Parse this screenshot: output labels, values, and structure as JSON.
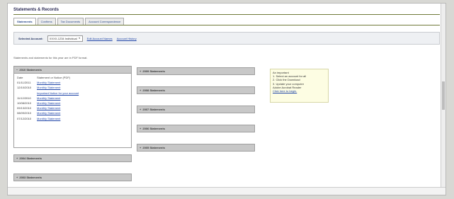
{
  "page": {
    "title": "Statements & Records",
    "intro": "Statements and statements for this year are in PDF format."
  },
  "tabs": [
    {
      "label": "Statements"
    },
    {
      "label": "Confirms"
    },
    {
      "label": "Tax Documents"
    },
    {
      "label": "Account Correspondence"
    }
  ],
  "account_bar": {
    "label": "Selected Account:",
    "selected": "XXXX-1234 Individual",
    "links": [
      "Edit Account Names",
      "Account History"
    ]
  },
  "panels": {
    "y2010": {
      "title": "2010 Statements",
      "columns": [
        "Date",
        "Statement or Notice (PDF)"
      ],
      "rows": [
        {
          "date": "01/11/2011",
          "label": "Monthly Statement"
        },
        {
          "date": "12/10/2010",
          "label": "Monthly Statement"
        },
        {
          "date": "",
          "label": "Important Notice for your account"
        },
        {
          "date": "11/12/2010",
          "label": "Monthly Statement"
        },
        {
          "date": "10/08/2010",
          "label": "Monthly Statement"
        },
        {
          "date": "09/13/2010",
          "label": "Monthly Statement"
        },
        {
          "date": "08/09/2010",
          "label": "Monthly Statement"
        },
        {
          "date": "07/12/2010",
          "label": "Monthly Statement"
        }
      ]
    },
    "y2009": {
      "title": "2009 Statements"
    },
    "y2008": {
      "title": "2008 Statements"
    },
    "y2007": {
      "title": "2007 Statements"
    },
    "y2006": {
      "title": "2006 Statements"
    },
    "y2005": {
      "title": "2005 Statements"
    },
    "y2004": {
      "title": "2004 Statements"
    },
    "y2003": {
      "title": "2003 Statements"
    }
  },
  "tip": {
    "lines": [
      "An important",
      "1. Select an account for all",
      "2. Click the Download",
      "3. Update your computer",
      "Adobe Acrobat Reader",
      "Click here to begin."
    ]
  },
  "icons": {
    "collapse": "minus-icon",
    "expand": "plus-icon"
  },
  "colors": {
    "link": "#1f45a8",
    "rule": "#6f7a3a",
    "panel_header": "#c8c8c8"
  }
}
